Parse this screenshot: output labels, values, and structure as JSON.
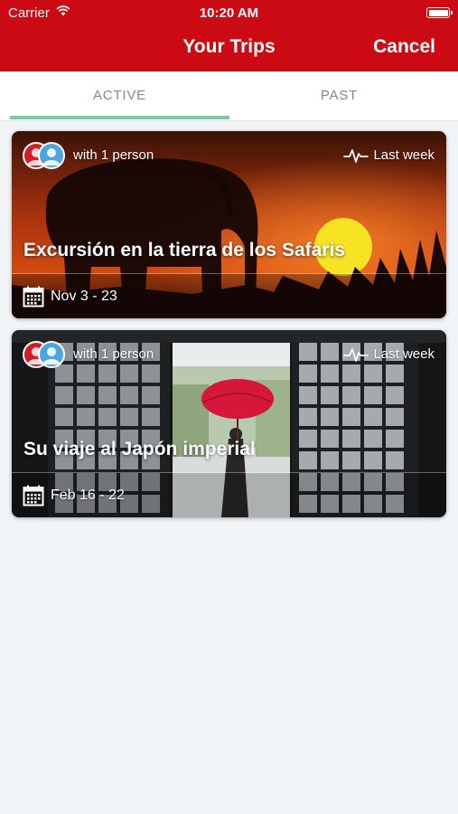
{
  "status_bar": {
    "carrier": "Carrier",
    "time": "10:20 AM"
  },
  "nav": {
    "title": "Your Trips",
    "cancel_label": "Cancel"
  },
  "tabs": [
    {
      "label": "ACTIVE",
      "selected": true
    },
    {
      "label": "PAST",
      "selected": false
    }
  ],
  "colors": {
    "header": "#cc0a14",
    "tab_indicator": "#7ccaa6",
    "background": "#f2f5f8"
  },
  "trips": [
    {
      "companions": "with 1 person",
      "activity_icon": "pulse-icon",
      "last_activity": "Last week",
      "title": "Excursión en la tierra de los Safaris",
      "calendar_icon": "calendar-icon",
      "dates": "Nov 3 - 23"
    },
    {
      "companions": "with 1 person",
      "activity_icon": "pulse-icon",
      "last_activity": "Last week",
      "title": "Su viaje al Japón imperial",
      "calendar_icon": "calendar-icon",
      "dates": "Feb 16 - 22"
    }
  ]
}
